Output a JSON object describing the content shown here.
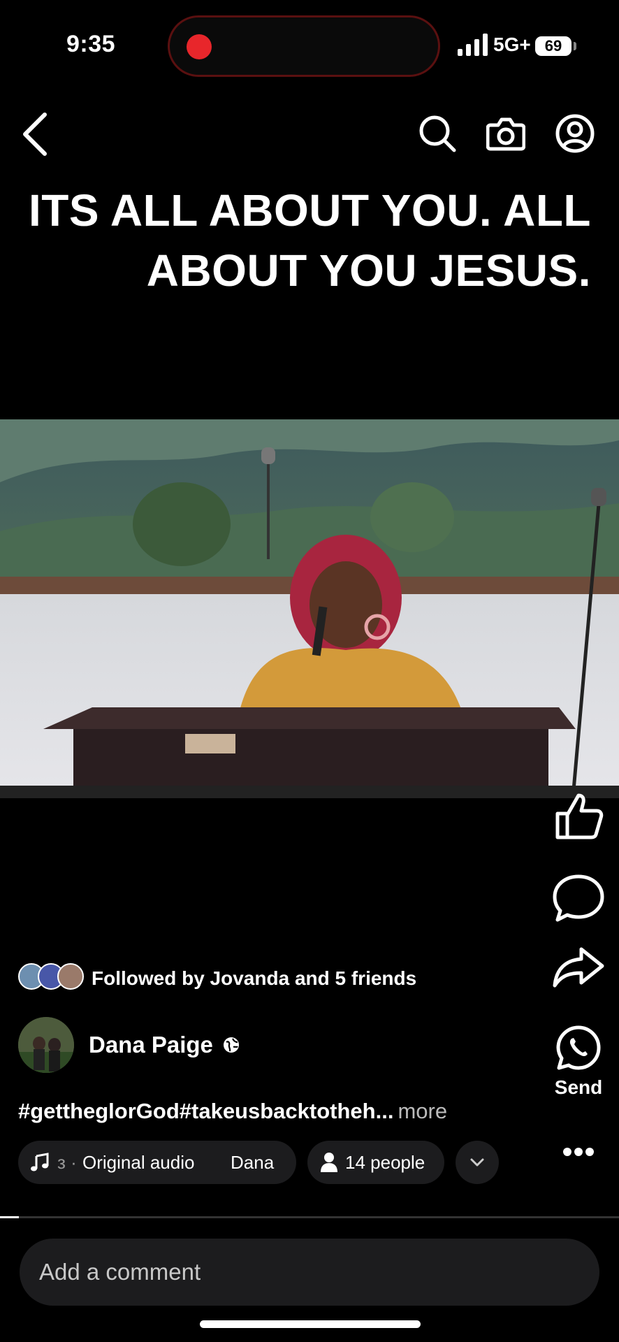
{
  "status_bar": {
    "time": "9:35",
    "network": "5G+",
    "battery": "69"
  },
  "nav": {
    "back_icon": "chevron-left-icon",
    "search_icon": "search-icon",
    "camera_icon": "camera-icon",
    "profile_icon": "profile-icon"
  },
  "overlay_text": "ITS ALL ABOUT  YOU. ALL ABOUT YOU JESUS.",
  "actions": {
    "send_label": "Send"
  },
  "social": {
    "followed_text": "Followed by Jovanda and 5 friends"
  },
  "author": {
    "name": "Dana Paige"
  },
  "caption": {
    "text": "#gettheglorGod#takeusbacktotheh...",
    "more": "more"
  },
  "chips": {
    "audio_prefix": "з ·",
    "audio_label": "Original audio",
    "audio_artist": "Dana",
    "people": "14 people"
  },
  "progress": {
    "fraction": 0.03
  },
  "comment": {
    "placeholder": "Add a comment"
  }
}
